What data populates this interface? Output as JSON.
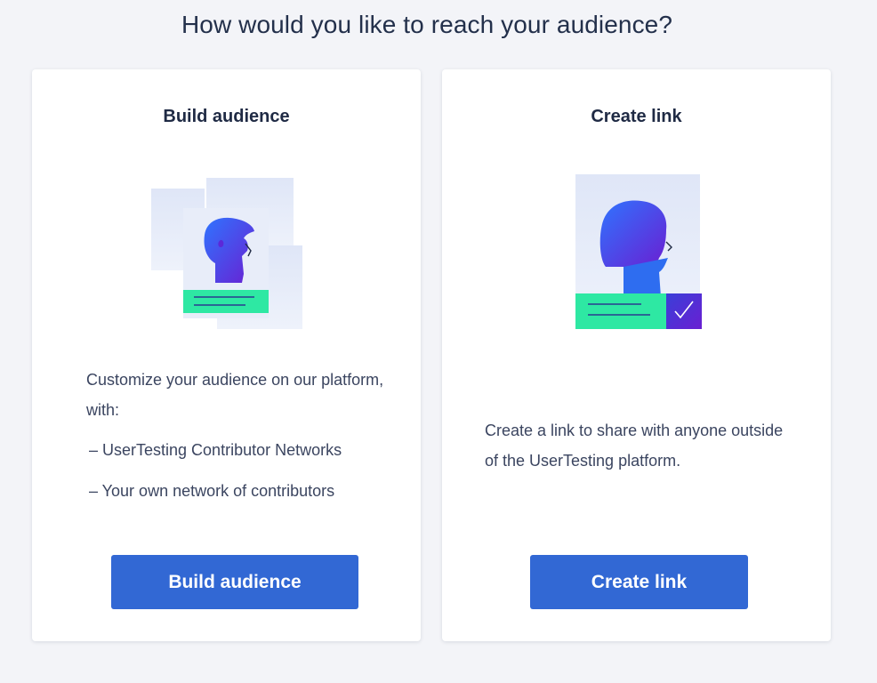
{
  "page": {
    "title": "How would you like to reach your audience?"
  },
  "cards": {
    "build": {
      "title": "Build audience",
      "description": "Customize your audience on our platform, with:",
      "items": [
        "– UserTesting Contributor Networks",
        "– Your own network of contributors"
      ],
      "button_label": "Build audience",
      "illustration_icon": "audience-people-icon"
    },
    "link": {
      "title": "Create link",
      "description": "Create a link to share with anyone outside of the UserTesting platform.",
      "button_label": "Create link",
      "illustration_icon": "link-person-check-icon"
    }
  },
  "colors": {
    "background": "#f3f4f8",
    "card": "#ffffff",
    "button": "#3268d4",
    "accent_green": "#2ee8a3",
    "accent_blue": "#2d6bff",
    "accent_purple": "#5a22d6",
    "illustration_panel": "#e2e8f7"
  }
}
